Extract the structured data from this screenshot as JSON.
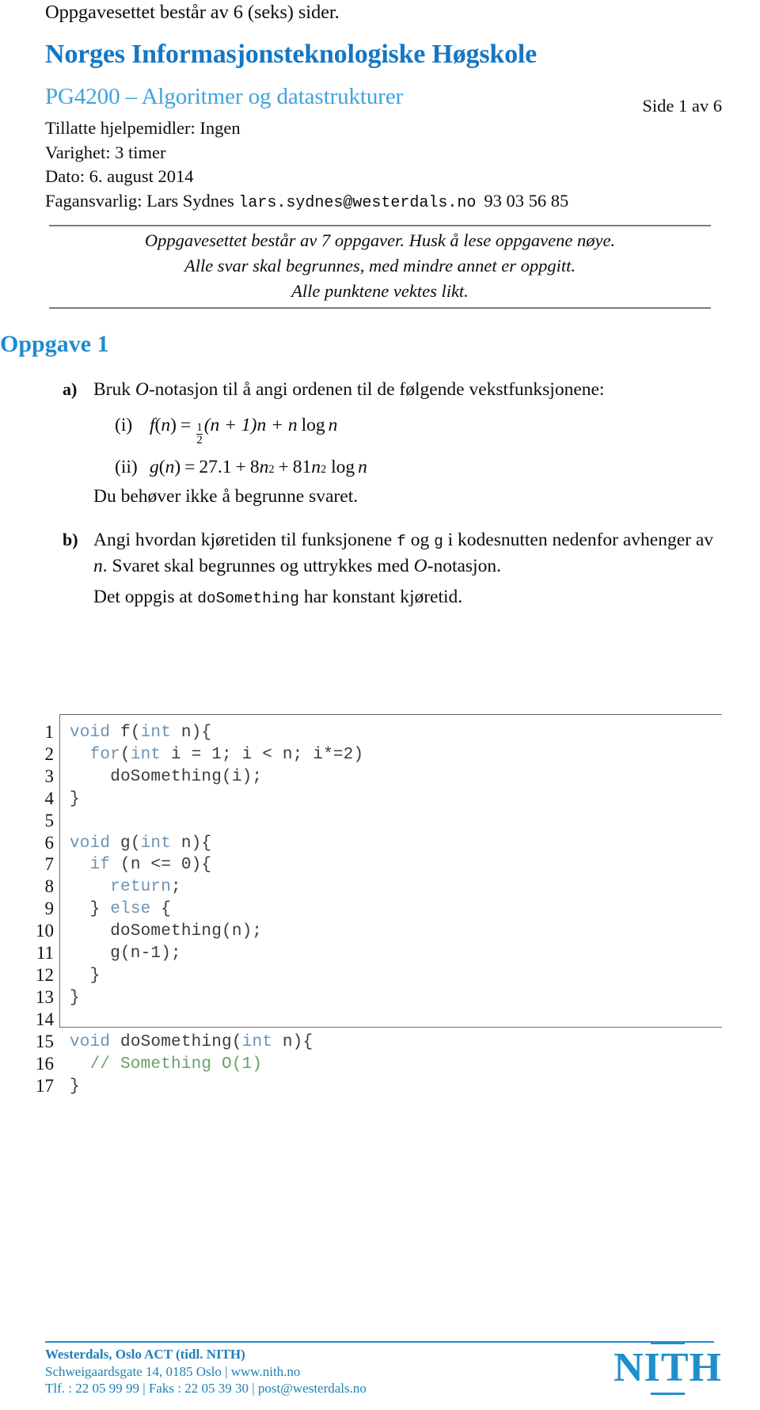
{
  "top_note": "Oppgavesettet består av  6 (seks) sider.",
  "header": {
    "institution": "Norges Informasjonsteknologiske Høgskole",
    "course": "PG4200 – Algoritmer og datastrukturer",
    "page_indicator": "Side 1 av 6",
    "aids_line": "Tillatte hjelpemidler: Ingen",
    "duration_line": "Varighet: 3 timer",
    "date_line": "Dato: 6. august 2014",
    "responsible_label": "Fagansvarlig: Lars Sydnes",
    "responsible_email": "lars.sydnes@westerdals.no",
    "responsible_phone": "93 03 56 85"
  },
  "notice": {
    "line1": "Oppgavesettet består av 7 oppgaver. Husk å lese oppgavene nøye.",
    "line2": "Alle svar skal begrunnes, med mindre annet er oppgitt.",
    "line3": "Alle punktene vektes likt."
  },
  "section": {
    "heading": "Oppgave 1"
  },
  "task_a": {
    "label": "a)",
    "intro_pre": "Bruk ",
    "intro_o": "O",
    "intro_post": "-notasjon til å angi ordenen til de følgende vekstfunksjonene:",
    "items": [
      {
        "num": "(i)",
        "fn": "f",
        "arg": "n",
        "expr_frac_num": "1",
        "expr_frac_den": "2",
        "expr_rest_a": "(n + 1)n + n",
        "expr_log": "log",
        "expr_rest_b": "n"
      },
      {
        "num": "(ii)",
        "fn": "g",
        "arg": "n",
        "c0": "27.1",
        "c1": "8",
        "c1_var": "n",
        "c1_exp": "2",
        "c2": "81",
        "c2_var": "n",
        "c2_exp": "2",
        "log": "log",
        "log_arg": "n"
      }
    ],
    "no_justify_note": "Du behøver ikke å begrunne svaret."
  },
  "task_b": {
    "label": "b)",
    "p1_a": "Angi hvordan kjøretiden til funksjonene ",
    "p1_f": "f",
    "p1_b": " og ",
    "p1_g": "g",
    "p1_c": " i kodesnutten nedenfor avhenger av ",
    "p1_n": "n",
    "p1_d": ". Svaret skal begrunnes og uttrykkes med ",
    "p1_o": "O",
    "p1_e": "-notasjon.",
    "p2_a": "Det oppgis at ",
    "p2_code": "doSomething",
    "p2_b": " har konstant kjøretid."
  },
  "code": {
    "line_numbers": [
      "1",
      "2",
      "3",
      "4",
      "5",
      "6",
      "7",
      "8",
      "9",
      "10",
      "11",
      "12",
      "13",
      "14",
      "15",
      "16",
      "17"
    ],
    "lines": [
      [
        {
          "t": "void",
          "c": "kw"
        },
        {
          "t": " f(",
          "c": ""
        },
        {
          "t": "int",
          "c": "kw"
        },
        {
          "t": " n){",
          "c": ""
        }
      ],
      [
        {
          "t": "  ",
          "c": ""
        },
        {
          "t": "for",
          "c": "kw"
        },
        {
          "t": "(",
          "c": ""
        },
        {
          "t": "int",
          "c": "kw"
        },
        {
          "t": " i = 1; i < n; i*=2)",
          "c": ""
        }
      ],
      [
        {
          "t": "    doSomething(i);",
          "c": ""
        }
      ],
      [
        {
          "t": "}",
          "c": ""
        }
      ],
      [
        {
          "t": "",
          "c": ""
        }
      ],
      [
        {
          "t": "void",
          "c": "kw"
        },
        {
          "t": " g(",
          "c": ""
        },
        {
          "t": "int",
          "c": "kw"
        },
        {
          "t": " n){",
          "c": ""
        }
      ],
      [
        {
          "t": "  ",
          "c": ""
        },
        {
          "t": "if",
          "c": "kw"
        },
        {
          "t": " (n <= 0){",
          "c": ""
        }
      ],
      [
        {
          "t": "    ",
          "c": ""
        },
        {
          "t": "return",
          "c": "kw"
        },
        {
          "t": ";",
          "c": ""
        }
      ],
      [
        {
          "t": "  } ",
          "c": ""
        },
        {
          "t": "else",
          "c": "kw"
        },
        {
          "t": " {",
          "c": ""
        }
      ],
      [
        {
          "t": "    doSomething(n);",
          "c": ""
        }
      ],
      [
        {
          "t": "    g(n-1);",
          "c": ""
        }
      ],
      [
        {
          "t": "  }",
          "c": ""
        }
      ],
      [
        {
          "t": "}",
          "c": ""
        }
      ],
      [
        {
          "t": "",
          "c": ""
        }
      ],
      [
        {
          "t": "void",
          "c": "kw"
        },
        {
          "t": " doSomething(",
          "c": ""
        },
        {
          "t": "int",
          "c": "kw"
        },
        {
          "t": " n){",
          "c": ""
        }
      ],
      [
        {
          "t": "  // Something O(1)",
          "c": "cm"
        }
      ],
      [
        {
          "t": "}",
          "c": ""
        }
      ]
    ]
  },
  "footer": {
    "line1": "Westerdals, Oslo ACT (tidl. NITH)",
    "line2": "Schweigaardsgate 14, 0185 Oslo  |  www.nith.no",
    "line3": "Tlf. : 22 05 99 99  |  Faks : 22 05 39 30  |  post@westerdals.no",
    "logo_text": "NITH"
  },
  "colors": {
    "brand_blue_dark": "#1577c4",
    "brand_blue_light": "#3ea3dd",
    "heading_blue": "#1e8bd0",
    "footer_blue": "#1f7fb8",
    "code_keyword": "#6c93b5",
    "code_comment": "#6aa06a"
  }
}
